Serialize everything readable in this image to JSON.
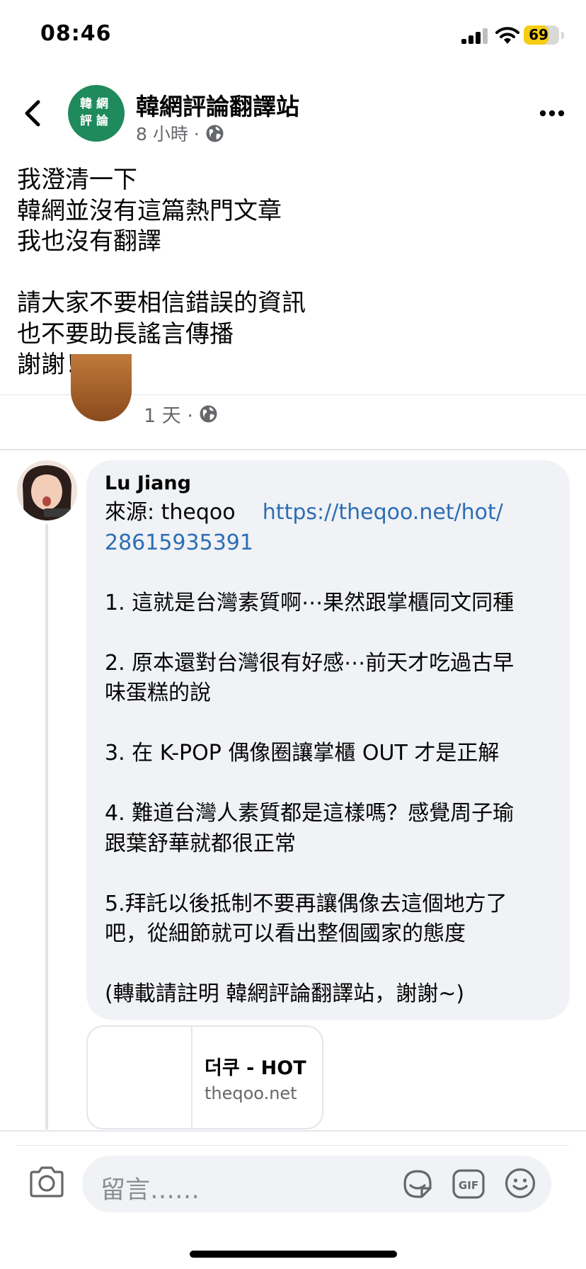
{
  "status_bar": {
    "time": "08:46",
    "battery": "69",
    "battery_level": 0.69
  },
  "post": {
    "page_name": "韓網評論翻譯站",
    "avatar_text": [
      "韓網",
      "評論"
    ],
    "time": "8 小時 ·",
    "body": [
      "我澄清一下",
      "韓網並沒有這篇熱門文章",
      "我也沒有翻譯",
      "",
      "請大家不要相信錯誤的資訊",
      "也不要助長謠言傳播",
      "謝謝！"
    ]
  },
  "previous_post": {
    "time": "1 天 ·"
  },
  "comment": {
    "author": "Lu Jiang",
    "source_label": "來源: theqoo",
    "link_part1": "https://theqoo.net/hot/",
    "link_part2": "28615935391",
    "lines": [
      "1. 這就是台灣素質啊⋯果然跟掌櫃同文同種",
      "2. 原本還對台灣很有好感⋯前天才吃過古早",
      "味蛋糕的說",
      "3. 在 K-POP 偶像圈讓掌櫃 OUT 才是正解",
      "4. 難道台灣人素質都是這樣嗎？感覺周子瑜",
      "跟葉舒華就都很正常",
      "5.拜託以後抵制不要再讓偶像去這個地方了",
      "吧，從細節就可以看出整個國家的態度",
      "(轉載請註明 韓網評論翻譯站，謝謝~)"
    ]
  },
  "link_card": {
    "title": "더쿠 - HOT",
    "domain": "theqoo.net"
  },
  "composer": {
    "placeholder": "留言……"
  },
  "colors": {
    "avatar_green": "#1f8a5c",
    "link_blue": "#2d6db5",
    "battery_yellow": "#f5cd12"
  },
  "icons": [
    "back-icon",
    "globe-icon",
    "more-icon",
    "camera-icon",
    "sticker-icon",
    "gif-icon",
    "emoji-icon"
  ]
}
